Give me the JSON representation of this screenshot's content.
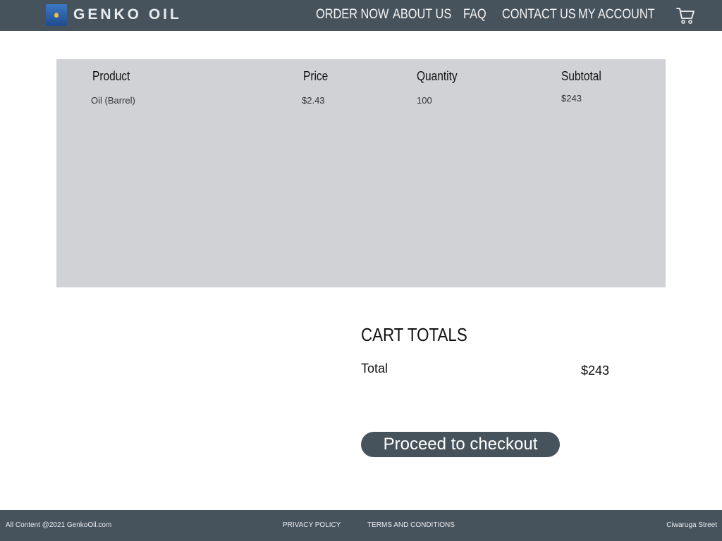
{
  "brand": {
    "name": "GENKO OIL",
    "logo_icon": "oil-drum-logo-icon"
  },
  "nav": {
    "order_now": "ORDER NOW",
    "about_us": "ABOUT US",
    "faq": "FAQ",
    "contact_us": "CONTACT US",
    "my_account": "MY ACCOUNT",
    "cart_icon": "shopping-cart-icon"
  },
  "cart": {
    "headers": {
      "product": "Product",
      "price": "Price",
      "quantity": "Quantity",
      "subtotal": "Subtotal"
    },
    "rows": [
      {
        "product": "Oil (Barrel)",
        "price": "$2.43",
        "quantity": "100",
        "subtotal": "$243"
      }
    ]
  },
  "totals": {
    "title": "CART TOTALS",
    "total_label": "Total",
    "total_value": "$243",
    "checkout_label": "Proceed to checkout"
  },
  "footer": {
    "copyright": "All Content @2021 GenkoOil.com",
    "privacy": "PRIVACY POLICY",
    "terms": "TERMS AND CONDITIONS",
    "address": "Ciwaruga Street"
  },
  "colors": {
    "header_bg": "#47535c",
    "panel_bg": "#d1d2d6",
    "button_bg": "#47535c"
  }
}
